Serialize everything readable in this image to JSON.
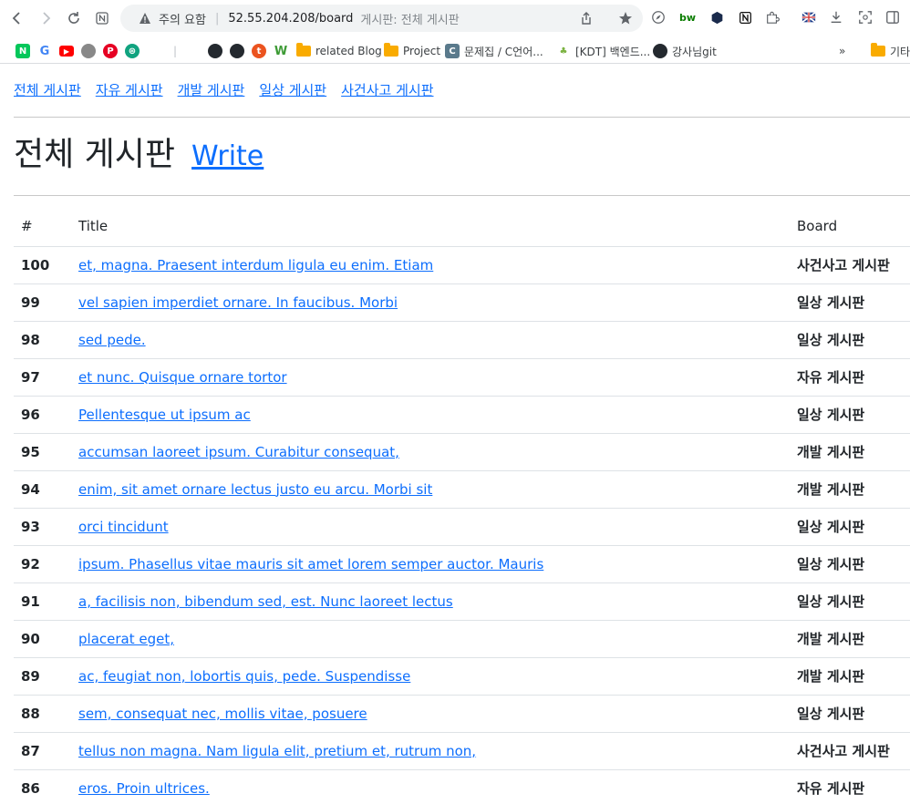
{
  "browser": {
    "security_warning": "주의 요함",
    "url": "52.55.204.208/board",
    "tab_title": "게시판: 전체 게시판",
    "bookmarks": [
      {
        "label": "",
        "icon": "naver-icon"
      },
      {
        "label": "",
        "icon": "google-icon"
      },
      {
        "label": "",
        "icon": "youtube-icon"
      },
      {
        "label": "",
        "icon": "apple-icon"
      },
      {
        "label": "",
        "icon": "pinterest-icon"
      },
      {
        "label": "",
        "icon": "chatgpt-icon"
      },
      {
        "label": "",
        "icon": "github-icon"
      },
      {
        "label": "",
        "icon": "github-icon"
      },
      {
        "label": "",
        "icon": "tistory-icon"
      },
      {
        "label": "",
        "icon": "w-icon"
      },
      {
        "label": "related Blog",
        "icon": "folder-icon"
      },
      {
        "label": "Project",
        "icon": "folder-icon"
      },
      {
        "label": "문제집 / C언어...",
        "icon": "c-icon"
      },
      {
        "label": "[KDT] 백엔드...",
        "icon": "kdt-icon"
      },
      {
        "label": "강사님git",
        "icon": "github-icon"
      },
      {
        "label": "»",
        "icon": ""
      },
      {
        "label": "기타",
        "icon": "folder-icon"
      }
    ]
  },
  "nav": {
    "links": [
      "전체 게시판",
      "자유 게시판",
      "개발 게시판",
      "일상 게시판",
      "사건사고 게시판"
    ]
  },
  "page": {
    "title": "전체 게시판",
    "write_label": "Write"
  },
  "table": {
    "headers": [
      "#",
      "Title",
      "Board"
    ],
    "rows": [
      {
        "id": "100",
        "title": "et, magna. Praesent interdum ligula eu enim. Etiam",
        "board": "사건사고 게시판"
      },
      {
        "id": "99",
        "title": "vel sapien imperdiet ornare. In faucibus. Morbi",
        "board": "일상 게시판"
      },
      {
        "id": "98",
        "title": "sed pede.",
        "board": "일상 게시판"
      },
      {
        "id": "97",
        "title": "et nunc. Quisque ornare tortor",
        "board": "자유 게시판"
      },
      {
        "id": "96",
        "title": "Pellentesque ut ipsum ac",
        "board": "일상 게시판"
      },
      {
        "id": "95",
        "title": "accumsan laoreet ipsum. Curabitur consequat,",
        "board": "개발 게시판"
      },
      {
        "id": "94",
        "title": "enim, sit amet ornare lectus justo eu arcu. Morbi sit",
        "board": "개발 게시판"
      },
      {
        "id": "93",
        "title": "orci tincidunt",
        "board": "일상 게시판"
      },
      {
        "id": "92",
        "title": "ipsum. Phasellus vitae mauris sit amet lorem semper auctor. Mauris",
        "board": "일상 게시판"
      },
      {
        "id": "91",
        "title": "a, facilisis non, bibendum sed, est. Nunc laoreet lectus",
        "board": "일상 게시판"
      },
      {
        "id": "90",
        "title": "placerat eget,",
        "board": "개발 게시판"
      },
      {
        "id": "89",
        "title": "ac, feugiat non, lobortis quis, pede. Suspendisse",
        "board": "개발 게시판"
      },
      {
        "id": "88",
        "title": "sem, consequat nec, mollis vitae, posuere",
        "board": "일상 게시판"
      },
      {
        "id": "87",
        "title": "tellus non magna. Nam ligula elit, pretium et, rutrum non,",
        "board": "사건사고 게시판"
      },
      {
        "id": "86",
        "title": "eros. Proin ultrices.",
        "board": "자유 게시판"
      }
    ]
  }
}
